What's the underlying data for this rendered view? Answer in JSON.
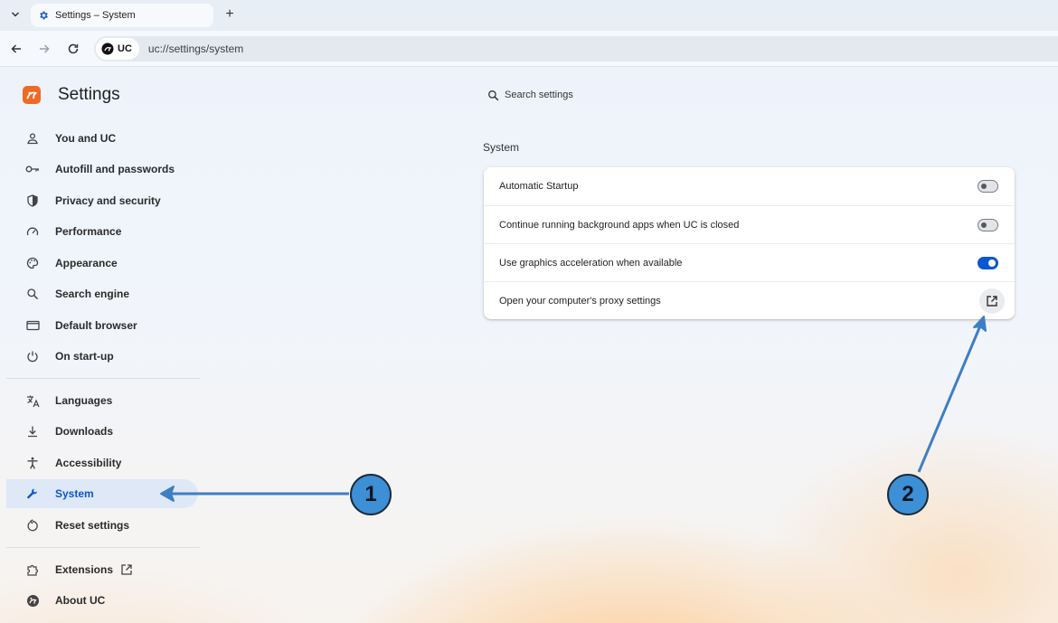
{
  "browser": {
    "tab_title": "Settings – System",
    "site_chip_label": "UC",
    "url": "uc://settings/system"
  },
  "sidebar": {
    "title": "Settings",
    "items": [
      {
        "label": "You and UC",
        "icon": "person-icon"
      },
      {
        "label": "Autofill and passwords",
        "icon": "key-icon"
      },
      {
        "label": "Privacy and security",
        "icon": "shield-icon"
      },
      {
        "label": "Performance",
        "icon": "speedometer-icon"
      },
      {
        "label": "Appearance",
        "icon": "palette-icon"
      },
      {
        "label": "Search engine",
        "icon": "search-icon"
      },
      {
        "label": "Default browser",
        "icon": "browser-window-icon"
      },
      {
        "label": "On start-up",
        "icon": "power-icon"
      },
      {
        "label": "Languages",
        "icon": "translate-icon"
      },
      {
        "label": "Downloads",
        "icon": "download-icon"
      },
      {
        "label": "Accessibility",
        "icon": "accessibility-icon"
      },
      {
        "label": "System",
        "icon": "wrench-icon",
        "active": true
      },
      {
        "label": "Reset settings",
        "icon": "reset-icon"
      },
      {
        "label": "Extensions",
        "icon": "puzzle-icon"
      },
      {
        "label": "About UC",
        "icon": "uc-logo-icon"
      }
    ]
  },
  "search": {
    "placeholder": "Search settings"
  },
  "main": {
    "section_title": "System",
    "rows": [
      {
        "label": "Automatic Startup",
        "control": "toggle",
        "on": false
      },
      {
        "label": "Continue running background apps when UC is closed",
        "control": "toggle",
        "on": false
      },
      {
        "label": "Use graphics acceleration when available",
        "control": "toggle",
        "on": true
      },
      {
        "label": "Open your computer's proxy settings",
        "control": "external-link"
      }
    ]
  },
  "annotations": {
    "badge_1": "1",
    "badge_2": "2",
    "arrow_color": "#3d7fc4"
  },
  "colors": {
    "accent": "#0b57d0",
    "brand": "#f06a24"
  }
}
